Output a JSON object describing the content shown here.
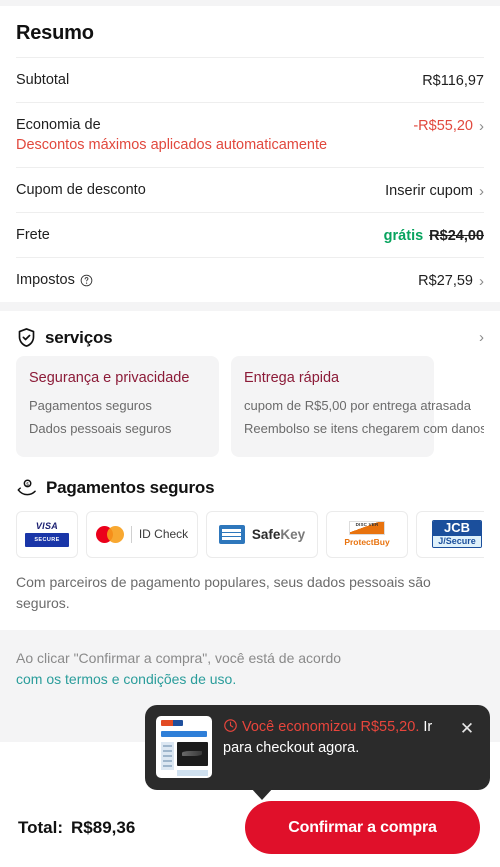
{
  "summary": {
    "title": "Resumo",
    "rows": [
      {
        "label": "Subtotal",
        "value": "R$116,97",
        "chevron": false
      },
      {
        "label": "Economia de",
        "sub": "Descontos máximos aplicados automaticamente",
        "value": "-R$55,20",
        "chevron": true
      },
      {
        "label": "Cupom de desconto",
        "value": "Inserir cupom",
        "chevron": true
      },
      {
        "label": "Frete",
        "free_label": "grátis",
        "value": "R$24,00",
        "chevron": false
      },
      {
        "label": "Impostos",
        "value": "R$27,59",
        "chevron": true,
        "info_icon": "question-circle-icon"
      }
    ]
  },
  "services": {
    "icon": "shield-check-icon",
    "title": "serviços",
    "chevron": "›",
    "cards": [
      {
        "title": "Segurança e privacidade",
        "lines": [
          "Pagamentos seguros",
          "Dados pessoais seguros"
        ]
      },
      {
        "title": "Entrega rápida",
        "lines": [
          "cupom de R$5,00 por entrega atrasada",
          "Reembolso se itens chegarem com danos"
        ]
      }
    ]
  },
  "payments": {
    "icon": "hand-coin-icon",
    "title": "Pagamentos seguros",
    "logos": [
      {
        "name": "visa-secure-logo",
        "word": "VISA",
        "sub": "SECURE"
      },
      {
        "name": "mastercard-id-check-logo",
        "text": "ID Check"
      },
      {
        "name": "amex-safekey-logo",
        "text": "SafeKey",
        "text_bold": "Safe",
        "text_light": "Key"
      },
      {
        "name": "discover-protectbuy-logo",
        "top": "DISC VER",
        "bottom": "ProtectBuy"
      },
      {
        "name": "jcb-jsecure-logo",
        "top": "JCB",
        "bottom": "J/Secure"
      }
    ],
    "note": "Com parceiros de pagamento populares, seus dados pessoais são seguros."
  },
  "footer": {
    "terms_prefix": "Ao clicar \"Confirmar a compra\", você está de acordo",
    "terms_link": "com os termos e condições de uso.",
    "total_label": "Total:",
    "total_value": "R$89,36",
    "cta_label": "Confirmar a compra"
  },
  "toast": {
    "icon": "clock-icon",
    "red_text": "Você economizou R$55,20.",
    "white_text": "Ir para checkout agora.",
    "close_icon": "close-icon",
    "thumbnail": "product-page-thumbnail"
  },
  "colors": {
    "accent_red": "#e0102a",
    "discount_red": "#e1483d",
    "free_green": "#07a35e",
    "card_title_maroon": "#8c1b38",
    "toast_bg": "#2b2b2b",
    "link_teal": "#2a9d9b"
  }
}
